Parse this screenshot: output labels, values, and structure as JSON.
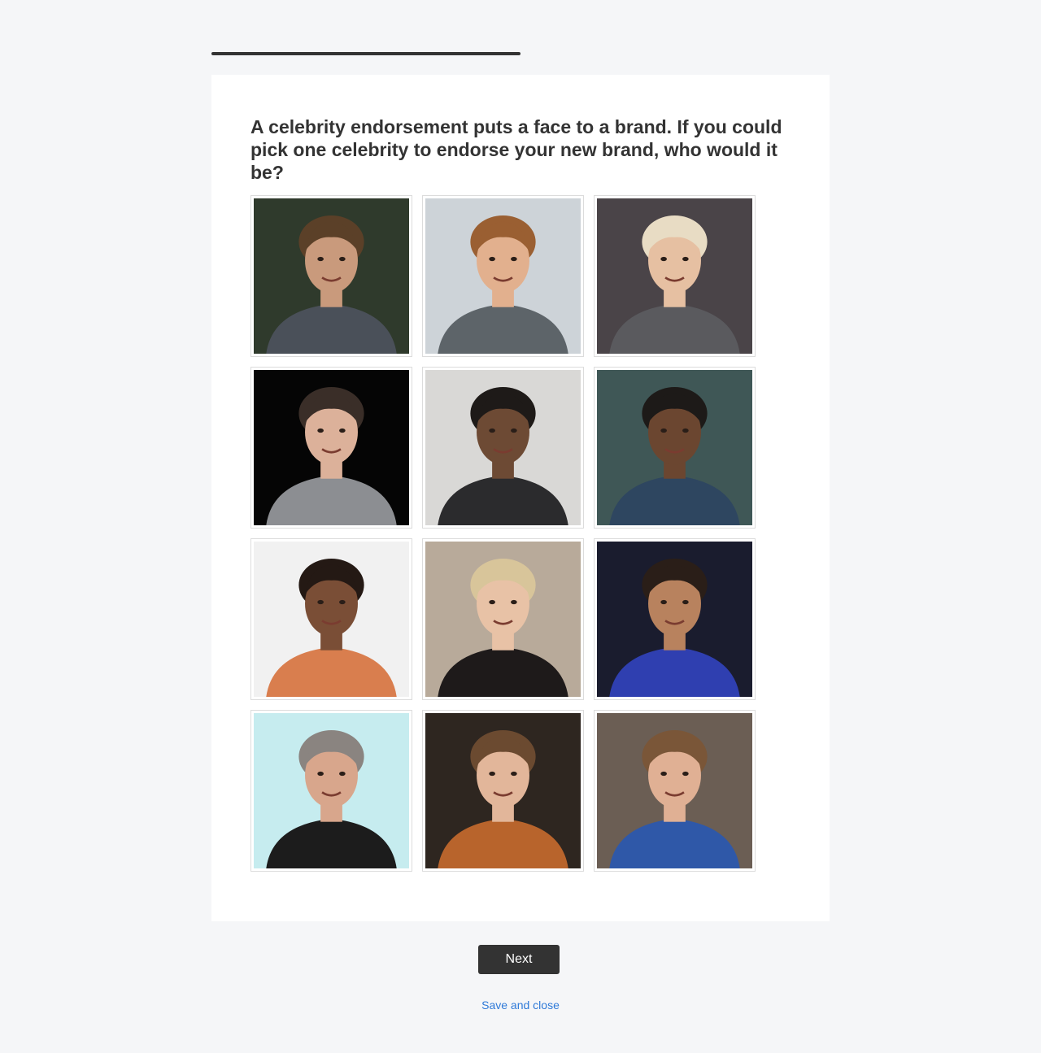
{
  "progress": {
    "fraction": 0.5
  },
  "question": {
    "text": "A celebrity endorsement puts a face to a brand. If you could pick one celebrity to endorse your new brand, who would it be?"
  },
  "options": [
    {
      "bg": "#2f3a2c",
      "skin": "#c99a7c",
      "hair": "#5b4028",
      "shirt": "#4a5059"
    },
    {
      "bg": "#cdd3d8",
      "skin": "#e2b08e",
      "hair": "#9a5f32",
      "shirt": "#5d6469"
    },
    {
      "bg": "#4a4448",
      "skin": "#e6c0a2",
      "hair": "#e8dcc4",
      "shirt": "#5a5a5e"
    },
    {
      "bg": "#050505",
      "skin": "#dcb19a",
      "hair": "#3a2e28",
      "shirt": "#8c8e92"
    },
    {
      "bg": "#d9d8d6",
      "skin": "#6d4a34",
      "hair": "#1e1a18",
      "shirt": "#2b2b2d"
    },
    {
      "bg": "#3f5756",
      "skin": "#6b4630",
      "hair": "#1d1a18",
      "shirt": "#2e4660"
    },
    {
      "bg": "#f1f1f1",
      "skin": "#7a4e36",
      "hair": "#241914",
      "shirt": "#d97e4e"
    },
    {
      "bg": "#b8aa9a",
      "skin": "#e8c2a6",
      "hair": "#d8c59a",
      "shirt": "#1e1a1a"
    },
    {
      "bg": "#1a1c2e",
      "skin": "#b8825e",
      "hair": "#2a1e18",
      "shirt": "#2f3fb0"
    },
    {
      "bg": "#c6ecef",
      "skin": "#d8a68c",
      "hair": "#8a8480",
      "shirt": "#1c1c1c"
    },
    {
      "bg": "#2e2620",
      "skin": "#e2b69a",
      "hair": "#6b4a30",
      "shirt": "#b8642c"
    },
    {
      "bg": "#6b5e54",
      "skin": "#e0b094",
      "hair": "#7a5638",
      "shirt": "#2f58a8"
    }
  ],
  "actions": {
    "next_label": "Next",
    "save_label": "Save and close"
  }
}
